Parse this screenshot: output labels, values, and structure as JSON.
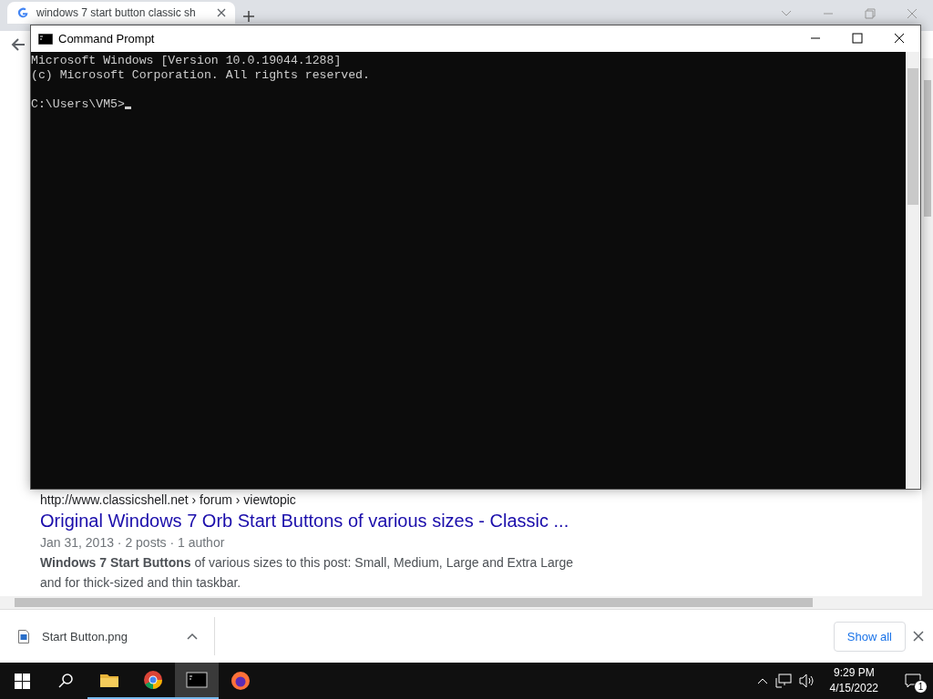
{
  "browser": {
    "tab": {
      "title": "windows 7 start button classic sh",
      "selected": true
    },
    "result": {
      "url": "http://www.classicshell.net › forum › viewtopic",
      "title": "Original Windows 7 Orb Start Buttons of various sizes - Classic ...",
      "meta": "Jan 31, 2013 · 2 posts · 1 author",
      "snippet": "**Windows 7 Start Buttons** of various sizes to this post: Small, Medium, Large and Extra Large and for thick-sized and thin taskbar."
    }
  },
  "download_bar": {
    "file": "Start Button.png",
    "show_all": "Show all"
  },
  "command_prompt": {
    "title": "Command Prompt",
    "lines": [
      "Microsoft Windows [Version 10.0.19044.1288]",
      "(c) Microsoft Corporation. All rights reserved."
    ],
    "prompt": "C:\\Users\\VM5>"
  },
  "taskbar": {
    "apps": [
      {
        "kind": "explorer",
        "running": true,
        "active": false
      },
      {
        "kind": "chrome",
        "running": true,
        "active": false
      },
      {
        "kind": "terminal",
        "running": true,
        "active": true
      },
      {
        "kind": "firefox",
        "running": false,
        "active": false
      }
    ],
    "time": "9:29 PM",
    "date": "4/15/2022",
    "notifications": "1"
  }
}
